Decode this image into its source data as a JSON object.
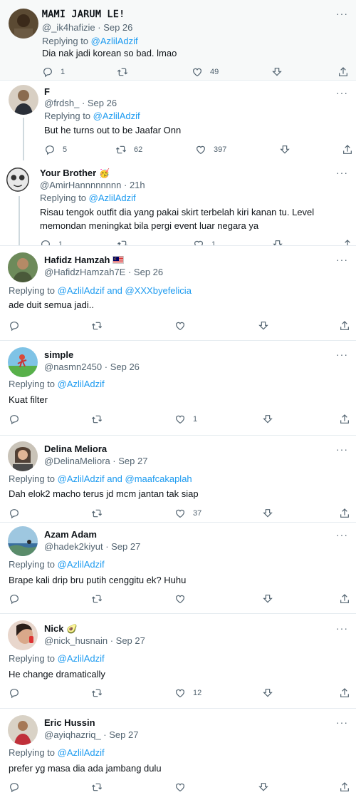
{
  "colors": {
    "link": "#1d9bf0",
    "muted": "#536471",
    "text": "#0f1419",
    "divider": "#e6ecf0"
  },
  "icons": [
    "reply-icon",
    "retweet-icon",
    "like-icon",
    "download-icon",
    "share-icon",
    "more-icon"
  ],
  "tweets": [
    {
      "name": "𝙼𝙰𝙼𝙸 𝙹𝙰𝚁𝚄𝙼 𝙻𝙴!",
      "handle": "@_ik4hafizie",
      "date": "Sep 26",
      "replying_label": "Replying to",
      "replying_to": "@AzlilAdzif",
      "text": "Dia nak jadi korean so bad. lmao",
      "replies": "1",
      "retweets": "",
      "likes": "49"
    },
    {
      "name": "F",
      "handle": "@frdsh_",
      "date": "Sep 26",
      "replying_label": "Replying to",
      "replying_to": "@AzlilAdzif",
      "text": "But he turns out to be Jaafar Onn",
      "replies": "5",
      "retweets": "62",
      "likes": "397"
    },
    {
      "name": "Your Brother",
      "name_emoji": "🥳",
      "handle": "@AmirHannnnnnnn",
      "date": "21h",
      "replying_label": "Replying to",
      "replying_to": "@AzlilAdzif",
      "text": "Risau tengok outfit dia yang pakai skirt terbelah kiri kanan tu. Level memondan meningkat bila pergi event luar negara ya",
      "replies": "1",
      "retweets": "",
      "likes": "1"
    },
    {
      "name": "Hafidz Hamzah",
      "handle": "@HafidzHamzah7E",
      "date": "Sep 26",
      "replying_label": "Replying to",
      "replying_to": "@AzlilAdzif and @XXXbyefelicia",
      "text": "ade duit semua jadi..",
      "replies": "",
      "retweets": "",
      "likes": ""
    },
    {
      "name": "simple",
      "handle": "@nasmn2450",
      "date": "Sep 26",
      "replying_label": "Replying to",
      "replying_to": "@AzlilAdzif",
      "text": "Kuat filter",
      "replies": "",
      "retweets": "",
      "likes": "1"
    },
    {
      "name": "Delina Meliora",
      "handle": "@DelinaMeliora",
      "date": "Sep 27",
      "replying_label": "Replying to",
      "replying_to": "@AzlilAdzif and @maafcakaplah",
      "text": "Dah elok2 macho terus jd mcm jantan tak siap",
      "replies": "",
      "retweets": "",
      "likes": "37"
    },
    {
      "name": "Azam Adam",
      "handle": "@hadek2kiyut",
      "date": "Sep 27",
      "replying_label": "Replying to",
      "replying_to": "@AzlilAdzif",
      "text": "Brape kali drip bru putih cenggitu ek? Huhu",
      "replies": "",
      "retweets": "",
      "likes": ""
    },
    {
      "name": "Nick",
      "name_emoji": "🥑",
      "handle": "@nick_husnain",
      "date": "Sep 27",
      "replying_label": "Replying to",
      "replying_to": "@AzlilAdzif",
      "text": "He change dramatically",
      "replies": "",
      "retweets": "",
      "likes": "12"
    },
    {
      "name": "Eric Hussin",
      "handle": "@ayiqhazriq_",
      "date": "Sep 27",
      "replying_label": "Replying to",
      "replying_to": "@AzlilAdzif",
      "text": "prefer yg masa dia ada jambang dulu",
      "replies": "",
      "retweets": "",
      "likes": ""
    }
  ]
}
